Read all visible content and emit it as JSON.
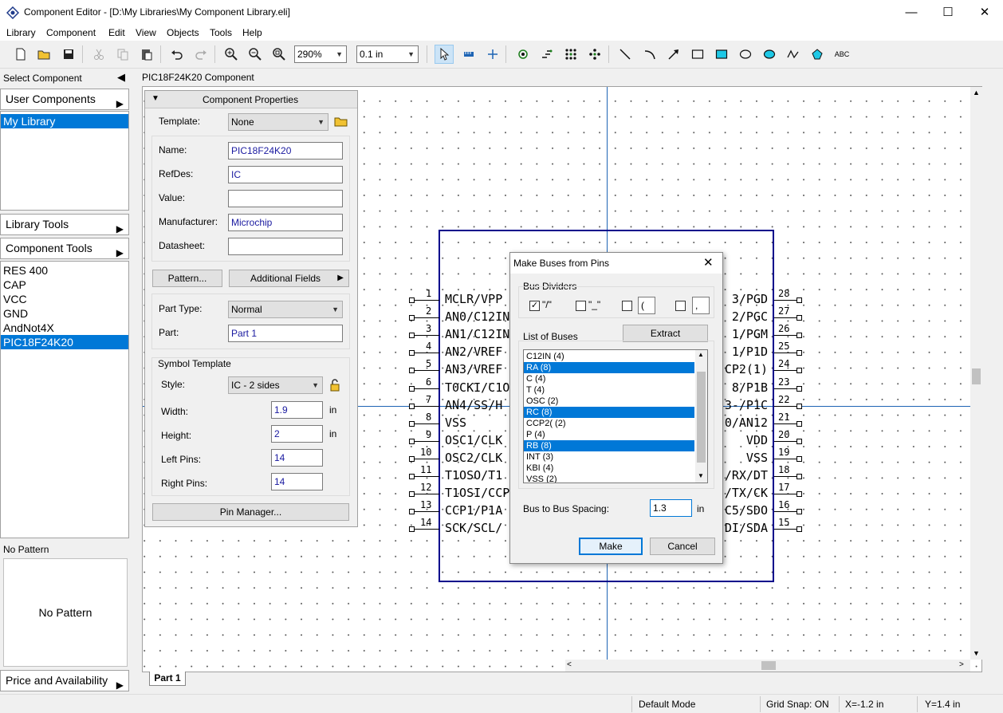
{
  "window": {
    "title": "Component Editor - [D:\\My Libraries\\My Component Library.eli]",
    "minimize": "—",
    "maximize": "☐",
    "close": "✕"
  },
  "menu": [
    "Library",
    "Component",
    "Edit",
    "View",
    "Objects",
    "Tools",
    "Help"
  ],
  "toolbar": {
    "zoom": "290%",
    "grid": "0.1 in",
    "icons": [
      "new-icon",
      "open-icon",
      "save-icon",
      "cut-icon",
      "copy-icon",
      "paste-icon",
      "undo-icon",
      "redo-icon",
      "zoom-in-icon",
      "zoom-out-icon",
      "zoom-fit-icon",
      "select-arrow-icon",
      "ruler-icon",
      "crosshair-icon",
      "add-pin-icon",
      "pin-array-icon",
      "pin-grid-icon",
      "pin-spread-icon",
      "line-icon",
      "arc-icon",
      "arrow-icon",
      "rectangle-icon",
      "filled-rectangle-icon",
      "ellipse-icon",
      "filled-ellipse-icon",
      "polyline-icon",
      "polygon-icon",
      "text-icon"
    ],
    "text_icon_label": "ABC"
  },
  "left_panel": {
    "select_component": "Select Component",
    "user_components": "User Components",
    "libraries": [
      "My Library"
    ],
    "library_tools": "Library Tools",
    "component_tools": "Component Tools",
    "components": [
      "RES 400",
      "CAP",
      "VCC",
      "GND",
      "AndNot4X",
      "PIC18F24K20"
    ],
    "selected_component": "PIC18F24K20",
    "pattern_header": "No Pattern",
    "pattern_preview": "No Pattern",
    "price_availability": "Price and Availability"
  },
  "editor": {
    "component_title": "PIC18F24K20 Component",
    "tab": "Part 1"
  },
  "properties": {
    "header": "Component Properties",
    "template_label": "Template:",
    "template_value": "None",
    "name_label": "Name:",
    "name_value": "PIC18F24K20",
    "refdes_label": "RefDes:",
    "refdes_value": "IC",
    "value_label": "Value:",
    "value_value": "",
    "manufacturer_label": "Manufacturer:",
    "manufacturer_value": "Microchip",
    "datasheet_label": "Datasheet:",
    "datasheet_value": "",
    "pattern_button": "Pattern...",
    "additional_fields_button": "Additional Fields",
    "part_type_label": "Part Type:",
    "part_type_value": "Normal",
    "part_label": "Part:",
    "part_value": "Part 1",
    "symbol_template_label": "Symbol Template",
    "style_label": "Style:",
    "style_value": "IC - 2 sides",
    "width_label": "Width:",
    "width_value": "1.9",
    "height_label": "Height:",
    "height_value": "2",
    "left_pins_label": "Left Pins:",
    "left_pins_value": "14",
    "right_pins_label": "Right Pins:",
    "right_pins_value": "14",
    "unit": "in",
    "pin_manager_button": "Pin Manager..."
  },
  "symbol": {
    "left_pins": [
      {
        "num": "1",
        "name": "MCLR/VPP"
      },
      {
        "num": "2",
        "name": "AN0/C12IN"
      },
      {
        "num": "3",
        "name": "AN1/C12IN"
      },
      {
        "num": "4",
        "name": "AN2/VREF"
      },
      {
        "num": "5",
        "name": "AN3/VREF"
      },
      {
        "num": "6",
        "name": "T0CKI/C1O"
      },
      {
        "num": "7",
        "name": "AN4/SS/H"
      },
      {
        "num": "8",
        "name": "VSS"
      },
      {
        "num": "9",
        "name": "OSC1/CLK"
      },
      {
        "num": "10",
        "name": "OSC2/CLK"
      },
      {
        "num": "11",
        "name": "T1OSO/T1"
      },
      {
        "num": "12",
        "name": "T1OSI/CCP"
      },
      {
        "num": "13",
        "name": "CCP1/P1A"
      },
      {
        "num": "14",
        "name": "SCK/SCL/"
      }
    ],
    "right_pins": [
      {
        "num": "28",
        "name": "3/PGD"
      },
      {
        "num": "27",
        "name": "2/PGC"
      },
      {
        "num": "26",
        "name": "1/PGM"
      },
      {
        "num": "25",
        "name": "1/P1D"
      },
      {
        "num": "24",
        "name": "CP2(1)"
      },
      {
        "num": "23",
        "name": "8/P1B"
      },
      {
        "num": "22",
        "name": "3-/P1C"
      },
      {
        "num": "21",
        "name": "0/AN12"
      },
      {
        "num": "20",
        "name": "VDD"
      },
      {
        "num": "19",
        "name": "VSS"
      },
      {
        "num": "18",
        "name": "/RX/DT"
      },
      {
        "num": "17",
        "name": "/TX/CK"
      },
      {
        "num": "16",
        "name": "C5/SDO"
      },
      {
        "num": "15",
        "name": "DI/SDA"
      }
    ]
  },
  "dialog": {
    "title": "Make Buses from Pins",
    "close": "✕",
    "bus_dividers_label": "Bus Dividers",
    "dividers": [
      {
        "label": "\"/\"",
        "checked": true
      },
      {
        "label": "\"_\"",
        "checked": false
      },
      {
        "label": "(",
        "checked": false
      },
      {
        "label": ",",
        "checked": false
      }
    ],
    "list_label": "List of Buses",
    "extract_button": "Extract",
    "buses": [
      {
        "label": "C12IN (4)",
        "selected": false
      },
      {
        "label": "RA (8)",
        "selected": true
      },
      {
        "label": "C (4)",
        "selected": false
      },
      {
        "label": "T (4)",
        "selected": false
      },
      {
        "label": "OSC (2)",
        "selected": false
      },
      {
        "label": "RC (8)",
        "selected": true
      },
      {
        "label": "CCP2( (2)",
        "selected": false
      },
      {
        "label": "P (4)",
        "selected": false
      },
      {
        "label": "RB (8)",
        "selected": true
      },
      {
        "label": "INT (3)",
        "selected": false
      },
      {
        "label": "KBI (4)",
        "selected": false
      },
      {
        "label": "VSS (2)",
        "selected": false
      }
    ],
    "spacing_label": "Bus to Bus Spacing:",
    "spacing_value": "1.3",
    "spacing_unit": "in",
    "make_button": "Make",
    "cancel_button": "Cancel"
  },
  "status": {
    "mode": "Default Mode",
    "grid_snap": "Grid Snap: ON",
    "x": "X=-1.2 in",
    "y": "Y=1.4 in"
  },
  "colors": {
    "selection": "#0078d7",
    "symbol_outline": "#00008b",
    "crosshair": "#1e64b4",
    "field_text": "#1a1aa0"
  }
}
